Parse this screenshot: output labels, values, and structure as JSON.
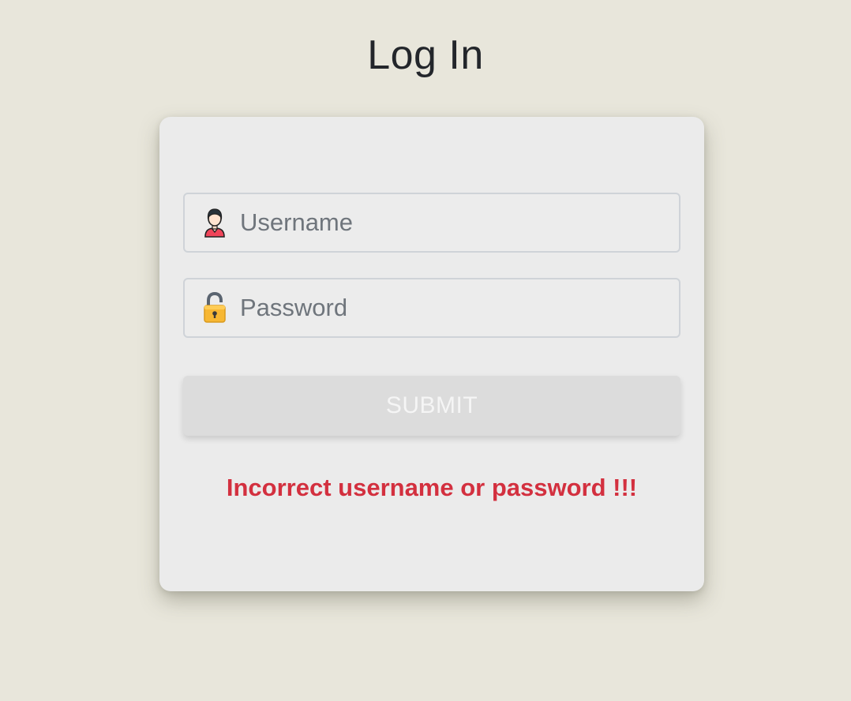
{
  "page": {
    "title": "Log In"
  },
  "form": {
    "username": {
      "placeholder": "Username",
      "value": "",
      "icon": "user-icon"
    },
    "password": {
      "placeholder": "Password",
      "value": "",
      "icon": "padlock-icon"
    },
    "submit_label": "SUBMIT",
    "error_message": "Incorrect username or password !!!"
  },
  "colors": {
    "background": "#e8e6db",
    "card": "#ebebeb",
    "error": "#d3303f",
    "submit_bg": "#dcdcdc",
    "title": "#23262b"
  }
}
